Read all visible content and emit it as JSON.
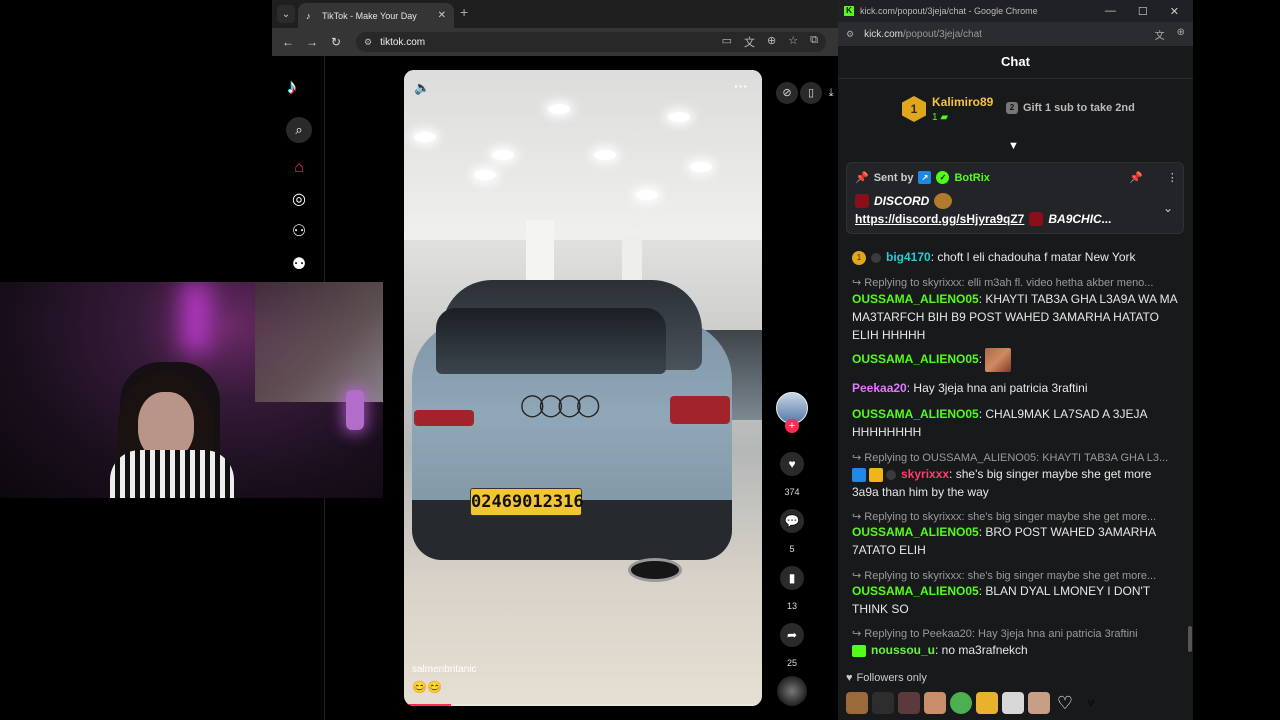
{
  "tiktok_browser": {
    "tab_title": "TikTok - Make Your Day",
    "url": "tiktok.com"
  },
  "tiktok": {
    "nav": [
      "tiktok-logo",
      "search-icon",
      "home-icon",
      "explore-icon",
      "following-icon",
      "friends-icon"
    ],
    "video": {
      "plate_text": "02469012316",
      "username": "salmenbritanic",
      "caption": "😊😊",
      "progress": 0.13
    },
    "actions": {
      "likes": "374",
      "comments": "5",
      "saves": "13",
      "shares": "25"
    }
  },
  "kick_browser": {
    "window_title": "kick.com/popout/3jeja/chat - Google Chrome",
    "url_host": "kick.com",
    "url_path": "/popout/3jeja/chat"
  },
  "chat": {
    "title": "Chat",
    "gift_leader": {
      "rank": "1",
      "username": "Kalimiro89",
      "count": "1",
      "cta_badge": "2",
      "cta": "Gift 1 sub to take 2nd"
    },
    "pinned": {
      "sent_by": "Sent by",
      "bot_name": "BotRix",
      "line1": "DISCORD",
      "link": "https://discord.gg/sHjyra9qZ7",
      "tail": "BA9CHIC..."
    },
    "messages": [
      {
        "kind": "msg",
        "badge": "1",
        "user": "big4170",
        "text": ": choft l eli chadouha f matar New York"
      },
      {
        "kind": "reply",
        "text": "Replying to skyrixxx: elli m3ah fl. video hetha akber meno..."
      },
      {
        "kind": "msg",
        "user": "OUSSAMA_ALIENO05",
        "text": ": KHAYTI TAB3A GHA L3A9A WA MA MA3TARFCH BIH B9 POST WAHED 3AMARHA HATATO ELIH HHHHH"
      },
      {
        "kind": "msg",
        "user": "OUSSAMA_ALIENO05",
        "text": ":"
      },
      {
        "kind": "msg",
        "user": "Peekaa20",
        "text": ": Hay 3jeja hna ani patricia 3raftini"
      },
      {
        "kind": "msg",
        "user": "OUSSAMA_ALIENO05",
        "text": ": CHAL9MAK LA7SAD A 3JEJA HHHHHHHH"
      },
      {
        "kind": "reply",
        "text": "Replying to OUSSAMA_ALIENO05: KHAYTI TAB3A GHA L3..."
      },
      {
        "kind": "msg",
        "user": "skyrixxx",
        "text": ": she's big singer maybe she get more 3a9a than him by the way"
      },
      {
        "kind": "reply",
        "text": "Replying to skyrixxx: she's big singer maybe she get more..."
      },
      {
        "kind": "msg",
        "user": "OUSSAMA_ALIENO05",
        "text": ": BRO POST WAHED 3AMARHA 7ATATO ELIH"
      },
      {
        "kind": "reply",
        "text": "Replying to skyrixxx: she's big singer maybe she get more..."
      },
      {
        "kind": "msg",
        "user": "OUSSAMA_ALIENO05",
        "text": ": BLAN DYAL LMONEY I DON'T THINK SO"
      },
      {
        "kind": "reply",
        "text": "Replying to Peekaa20: Hay 3jeja hna ani patricia 3raftini"
      },
      {
        "kind": "msg",
        "user": "noussou_u",
        "text": ": no ma3rafnekch"
      }
    ],
    "followers_only": "Followers only"
  }
}
